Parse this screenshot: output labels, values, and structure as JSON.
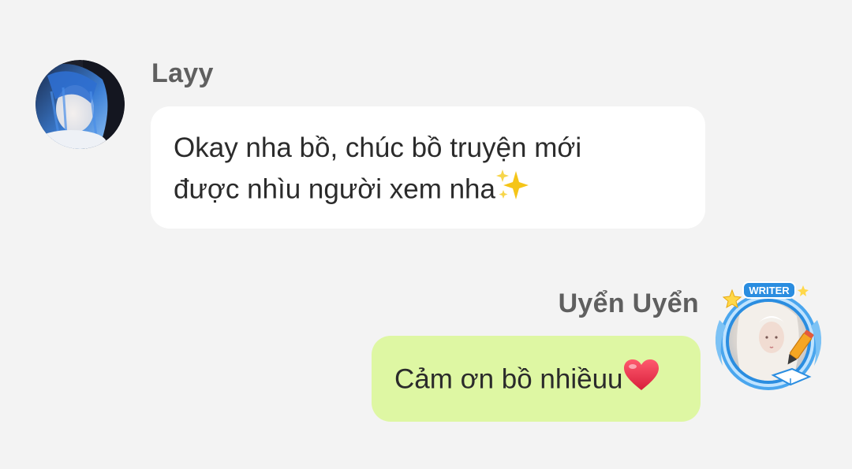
{
  "messages": [
    {
      "sender": "Layy",
      "side": "left",
      "text": "Okay nha bồ, chúc bồ truyện mới\nđược nhìu người xem nha",
      "trailing_emoji": "sparkles-icon",
      "bubble_color": "#ffffff"
    },
    {
      "sender": "Uyển Uyển",
      "side": "right",
      "text": "Cảm ơn bồ nhiềuu",
      "trailing_emoji": "heart-icon",
      "bubble_color": "#def7a3",
      "avatar_badge": "WRITER"
    }
  ],
  "colors": {
    "background": "#f3f3f3",
    "name_text": "#5f5f5f",
    "message_text": "#2b2b2b",
    "outgoing_bubble": "#def7a3",
    "incoming_bubble": "#ffffff",
    "badge_blue": "#2a8de0",
    "heart_red": "#e8304a",
    "sparkle_gold": "#f5c518"
  }
}
